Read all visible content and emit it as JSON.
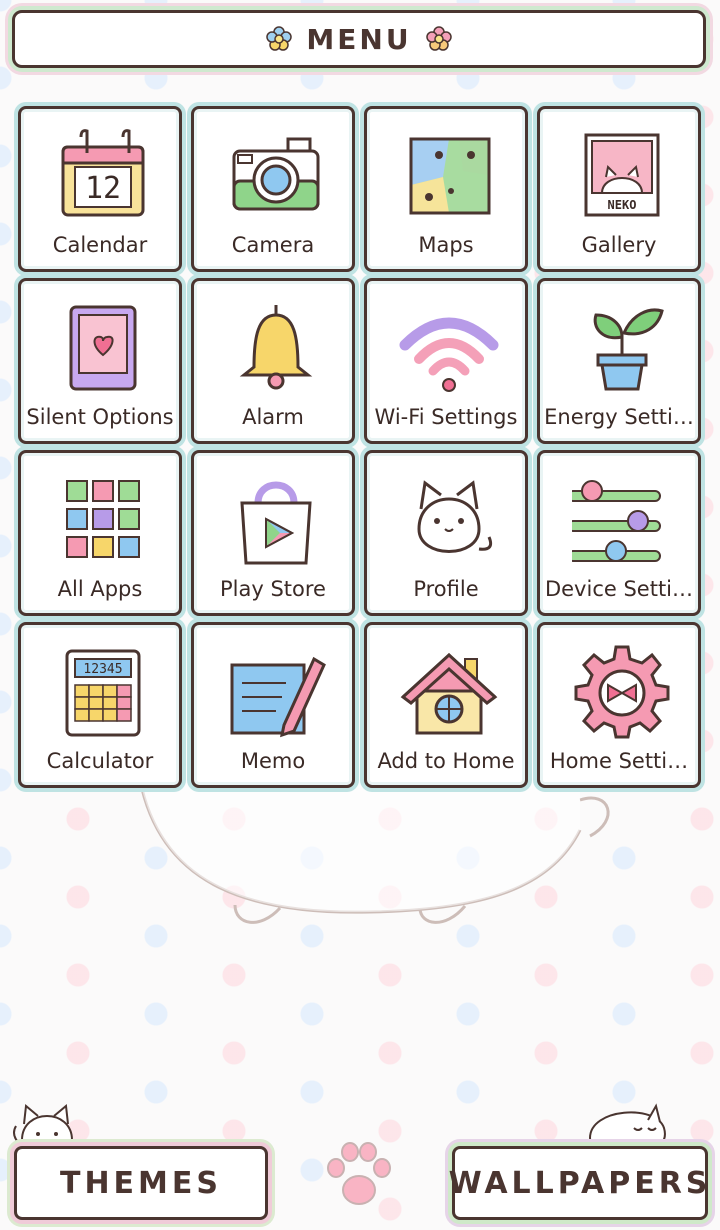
{
  "header": {
    "title": "MENU",
    "left_icon": "flower-icon",
    "right_icon": "flower-icon"
  },
  "tiles": [
    {
      "label": "Calendar",
      "icon": "calendar-icon",
      "day": "12"
    },
    {
      "label": "Camera",
      "icon": "camera-icon"
    },
    {
      "label": "Maps",
      "icon": "map-icon"
    },
    {
      "label": "Gallery",
      "icon": "photo-icon",
      "caption": "NEKO"
    },
    {
      "label": "Silent Options",
      "icon": "tablet-heart-icon"
    },
    {
      "label": "Alarm",
      "icon": "bell-icon"
    },
    {
      "label": "Wi-Fi Settings",
      "icon": "wifi-icon"
    },
    {
      "label": "Energy Setti…",
      "icon": "plant-icon"
    },
    {
      "label": "All Apps",
      "icon": "app-grid-icon"
    },
    {
      "label": "Play Store",
      "icon": "shopping-bag-icon"
    },
    {
      "label": "Profile",
      "icon": "cat-icon"
    },
    {
      "label": "Device Setti…",
      "icon": "sliders-icon"
    },
    {
      "label": "Calculator",
      "icon": "calculator-icon",
      "display": "12345"
    },
    {
      "label": "Memo",
      "icon": "memo-pencil-icon"
    },
    {
      "label": "Add to Home",
      "icon": "house-icon"
    },
    {
      "label": "Home Setti…",
      "icon": "gear-icon"
    }
  ],
  "footer": {
    "themes_label": "THEMES",
    "wallpapers_label": "WALLPAPERS",
    "center_icon": "paw-icon"
  },
  "colors": {
    "outline": "#4a3530",
    "tile_frame": "#bfe3e3",
    "pink": "#f28fa7",
    "yellow": "#f7d66a",
    "green": "#8fd48a",
    "blue": "#8fc8f0",
    "purple": "#b79be8"
  }
}
